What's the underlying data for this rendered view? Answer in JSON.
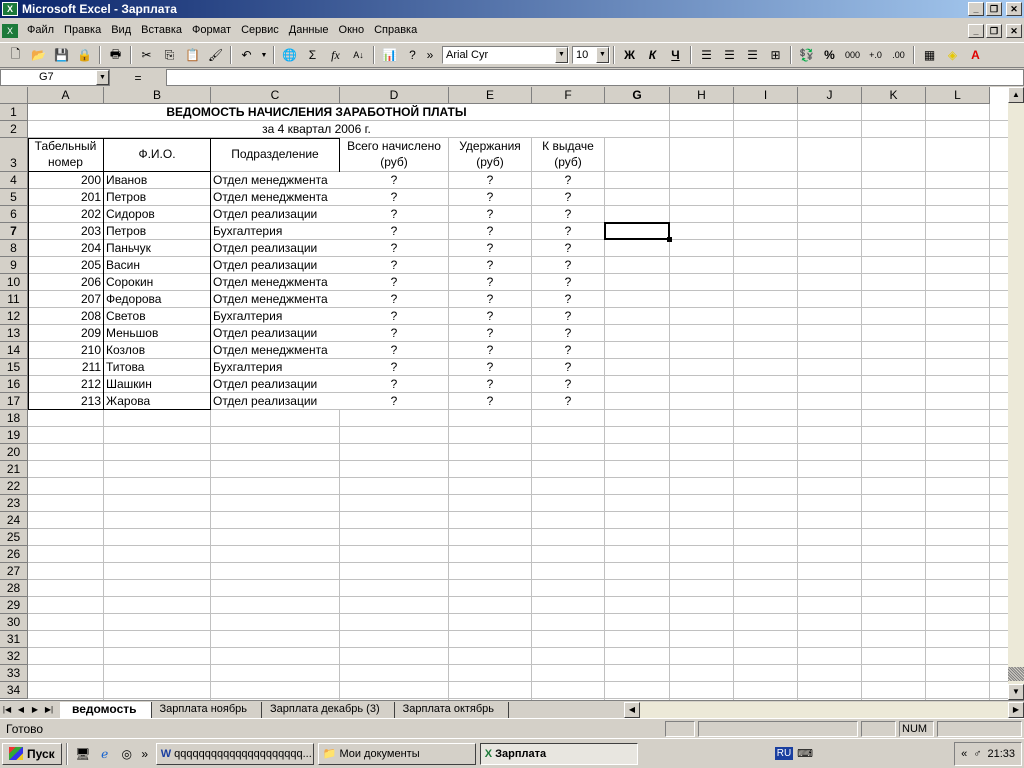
{
  "window": {
    "title": "Microsoft Excel - Зарплата"
  },
  "menu": [
    "Файл",
    "Правка",
    "Вид",
    "Вставка",
    "Формат",
    "Сервис",
    "Данные",
    "Окно",
    "Справка"
  ],
  "toolbar": {
    "font": "Arial Cyr",
    "size": "10",
    "bold": "Ж",
    "italic": "К",
    "underline": "Ч",
    "percent": "%",
    "thousands": "000"
  },
  "formula_bar": {
    "name_box": "G7",
    "equals": "="
  },
  "columns": [
    "A",
    "B",
    "C",
    "D",
    "E",
    "F",
    "G",
    "H",
    "I",
    "J",
    "K",
    "L"
  ],
  "rows": [
    "1",
    "2",
    "3",
    "4",
    "5",
    "6",
    "7",
    "8",
    "9",
    "10",
    "11",
    "12",
    "13",
    "14",
    "15",
    "16",
    "17",
    "18",
    "19",
    "20",
    "21",
    "22",
    "23",
    "24",
    "25",
    "26",
    "27",
    "28",
    "29",
    "30",
    "31",
    "32",
    "33",
    "34"
  ],
  "sheet": {
    "title": "ВЕДОМОСТЬ НАЧИСЛЕНИЯ ЗАРАБОТНОЙ ПЛАТЫ",
    "subtitle": "за 4 квартал 2006 г.",
    "headers": {
      "a1": "Табельный",
      "a2": "номер",
      "b": "Ф.И.О.",
      "c": "Подразделение",
      "d1": "Всего начислено",
      "d2": "(руб)",
      "e1": "Удержания",
      "e2": "(руб)",
      "f1": "К выдаче",
      "f2": "(руб)"
    },
    "data": [
      {
        "id": "200",
        "name": "Иванов",
        "dept": "Отдел менеджмента",
        "d": "?",
        "e": "?",
        "f": "?"
      },
      {
        "id": "201",
        "name": "Петров",
        "dept": "Отдел менеджмента",
        "d": "?",
        "e": "?",
        "f": "?"
      },
      {
        "id": "202",
        "name": "Сидоров",
        "dept": "Отдел реализации",
        "d": "?",
        "e": "?",
        "f": "?"
      },
      {
        "id": "203",
        "name": "Петров",
        "dept": "Бухгалтерия",
        "d": "?",
        "e": "?",
        "f": "?"
      },
      {
        "id": "204",
        "name": "Паньчук",
        "dept": "Отдел реализации",
        "d": "?",
        "e": "?",
        "f": "?"
      },
      {
        "id": "205",
        "name": "Васин",
        "dept": "Отдел реализации",
        "d": "?",
        "e": "?",
        "f": "?"
      },
      {
        "id": "206",
        "name": "Сорокин",
        "dept": "Отдел менеджмента",
        "d": "?",
        "e": "?",
        "f": "?"
      },
      {
        "id": "207",
        "name": "Федорова",
        "dept": "Отдел менеджмента",
        "d": "?",
        "e": "?",
        "f": "?"
      },
      {
        "id": "208",
        "name": "Светов",
        "dept": "Бухгалтерия",
        "d": "?",
        "e": "?",
        "f": "?"
      },
      {
        "id": "209",
        "name": "Меньшов",
        "dept": "Отдел реализации",
        "d": "?",
        "e": "?",
        "f": "?"
      },
      {
        "id": "210",
        "name": "Козлов",
        "dept": "Отдел менеджмента",
        "d": "?",
        "e": "?",
        "f": "?"
      },
      {
        "id": "211",
        "name": "Титова",
        "dept": "Бухгалтерия",
        "d": "?",
        "e": "?",
        "f": "?"
      },
      {
        "id": "212",
        "name": "Шашкин",
        "dept": "Отдел реализации",
        "d": "?",
        "e": "?",
        "f": "?"
      },
      {
        "id": "213",
        "name": "Жарова",
        "dept": "Отдел реализации",
        "d": "?",
        "e": "?",
        "f": "?"
      }
    ]
  },
  "sheet_tabs": [
    "ведомость",
    "Зарплата ноябрь",
    "Зарплата декабрь (3)",
    "Зарплата октябрь"
  ],
  "status": {
    "ready": "Готово",
    "num": "NUM"
  },
  "taskbar": {
    "start": "Пуск",
    "tasks": [
      "qqqqqqqqqqqqqqqqqqqqq...",
      "Мои документы",
      "Зарплата"
    ],
    "lang": "RU",
    "clock": "21:33"
  }
}
